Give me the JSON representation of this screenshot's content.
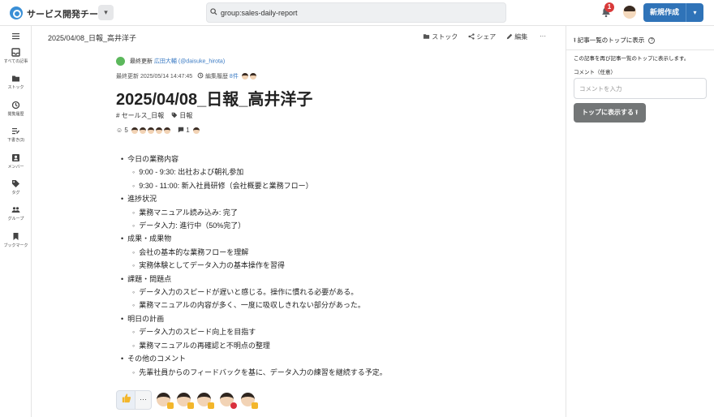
{
  "header": {
    "team_name": "サービス開発チーム",
    "search_value": "group:sales-daily-report",
    "notification_count": "1",
    "new_button_label": "新規作成"
  },
  "sidebar": {
    "items": [
      {
        "label": "すべての記事",
        "icon": "inbox-icon"
      },
      {
        "label": "ストック",
        "icon": "folder-icon"
      },
      {
        "label": "閲覧履歴",
        "icon": "history-icon"
      },
      {
        "label": "下書き(3)",
        "icon": "draft-icon"
      },
      {
        "label": "メンバー",
        "icon": "member-icon"
      },
      {
        "label": "タグ",
        "icon": "tag-icon"
      },
      {
        "label": "グループ",
        "icon": "group-icon"
      },
      {
        "label": "ブックマーク",
        "icon": "bookmark-icon"
      }
    ]
  },
  "topbar": {
    "breadcrumb": "2025/04/08_日報_高井洋子",
    "stock_label": "ストック",
    "share_label": "シェア",
    "edit_label": "編集",
    "more_label": "···"
  },
  "article": {
    "last_editor_prefix": "最終更新",
    "last_editor_name": "広田大輔",
    "last_editor_handle": "(@daisuke_hirota)",
    "updated_at": "最終更新 2025/05/14 14:47:45",
    "history_label": "編集履歴",
    "history_count": "8件",
    "title": "2025/04/08_日報_高井洋子",
    "tag_group": "セールス_日報",
    "tag_label": "日報",
    "reaction_count": "5",
    "comment_count": "1",
    "sections": [
      {
        "heading": "今日の業務内容",
        "items": [
          "9:00 - 9:30: 出社および朝礼参加",
          "9:30 - 11:00: 新入社員研修（会社概要と業務フロー）"
        ]
      },
      {
        "heading": "進捗状況",
        "items": [
          "業務マニュアル読み込み: 完了",
          "データ入力: 進行中（50%完了）"
        ]
      },
      {
        "heading": "成果・成果物",
        "items": [
          "会社の基本的な業務フローを理解",
          "実務体験としてデータ入力の基本操作を習得"
        ]
      },
      {
        "heading": "課題・問題点",
        "items": [
          "データ入力のスピードが遅いと感じる。操作に慣れる必要がある。",
          "業務マニュアルの内容が多く、一度に吸収しきれない部分があった。"
        ]
      },
      {
        "heading": "明日の計画",
        "items": [
          "データ入力のスピード向上を目指す",
          "業務マニュアルの再確認と不明点の整理"
        ]
      },
      {
        "heading": "その他のコメント",
        "items": [
          "先輩社員からのフィードバックを基に、データ入力の練習を継続する予定。"
        ]
      }
    ]
  },
  "reactions": {
    "like_icon": "thumbs-up-icon",
    "more_label": "···"
  },
  "right_panel": {
    "heading": "記事一覧のトップに表示",
    "description": "この記事を再び記事一覧のトップに表示します。",
    "comment_label": "コメント（任意）",
    "comment_placeholder": "コメントを入力",
    "button_label": "トップに表示する"
  },
  "colors": {
    "accent": "#2f73b8",
    "link": "#3b7bc4",
    "button_gray": "#737677",
    "badge": "#d93a3a"
  }
}
